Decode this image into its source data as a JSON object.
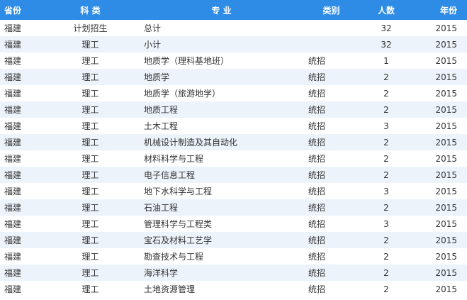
{
  "headers": {
    "province": "省份",
    "kind": "科 类",
    "major": "专 业",
    "category": "类别",
    "count": "人数",
    "year": "年份"
  },
  "rows": [
    {
      "province": "福建",
      "kind": "计划招生",
      "major": "总计",
      "category": "",
      "count": "32",
      "year": "2015"
    },
    {
      "province": "福建",
      "kind": "理工",
      "major": "小计",
      "category": "",
      "count": "32",
      "year": "2015"
    },
    {
      "province": "福建",
      "kind": "理工",
      "major": "地质学（理科基地班）",
      "category": "统招",
      "count": "1",
      "year": "2015"
    },
    {
      "province": "福建",
      "kind": "理工",
      "major": "地质学",
      "category": "统招",
      "count": "2",
      "year": "2015"
    },
    {
      "province": "福建",
      "kind": "理工",
      "major": "地质学（旅游地学）",
      "category": "统招",
      "count": "2",
      "year": "2015"
    },
    {
      "province": "福建",
      "kind": "理工",
      "major": "地质工程",
      "category": "统招",
      "count": "2",
      "year": "2015"
    },
    {
      "province": "福建",
      "kind": "理工",
      "major": "土木工程",
      "category": "统招",
      "count": "3",
      "year": "2015"
    },
    {
      "province": "福建",
      "kind": "理工",
      "major": "机械设计制造及其自动化",
      "category": "统招",
      "count": "2",
      "year": "2015"
    },
    {
      "province": "福建",
      "kind": "理工",
      "major": "材料科学与工程",
      "category": "统招",
      "count": "2",
      "year": "2015"
    },
    {
      "province": "福建",
      "kind": "理工",
      "major": "电子信息工程",
      "category": "统招",
      "count": "2",
      "year": "2015"
    },
    {
      "province": "福建",
      "kind": "理工",
      "major": "地下水科学与工程",
      "category": "统招",
      "count": "3",
      "year": "2015"
    },
    {
      "province": "福建",
      "kind": "理工",
      "major": "石油工程",
      "category": "统招",
      "count": "2",
      "year": "2015"
    },
    {
      "province": "福建",
      "kind": "理工",
      "major": "管理科学与工程类",
      "category": "统招",
      "count": "3",
      "year": "2015"
    },
    {
      "province": "福建",
      "kind": "理工",
      "major": "宝石及材料工艺学",
      "category": "统招",
      "count": "2",
      "year": "2015"
    },
    {
      "province": "福建",
      "kind": "理工",
      "major": "勘查技术与工程",
      "category": "统招",
      "count": "2",
      "year": "2015"
    },
    {
      "province": "福建",
      "kind": "理工",
      "major": "海洋科学",
      "category": "统招",
      "count": "2",
      "year": "2015"
    },
    {
      "province": "福建",
      "kind": "理工",
      "major": "土地资源管理",
      "category": "统招",
      "count": "2",
      "year": "2015"
    }
  ],
  "colors": {
    "header_bg": "#2e8ce6",
    "header_text": "#ffffff",
    "row_alt_bg": "#edf3fb",
    "row_bg": "#ffffff",
    "text": "#333333"
  }
}
